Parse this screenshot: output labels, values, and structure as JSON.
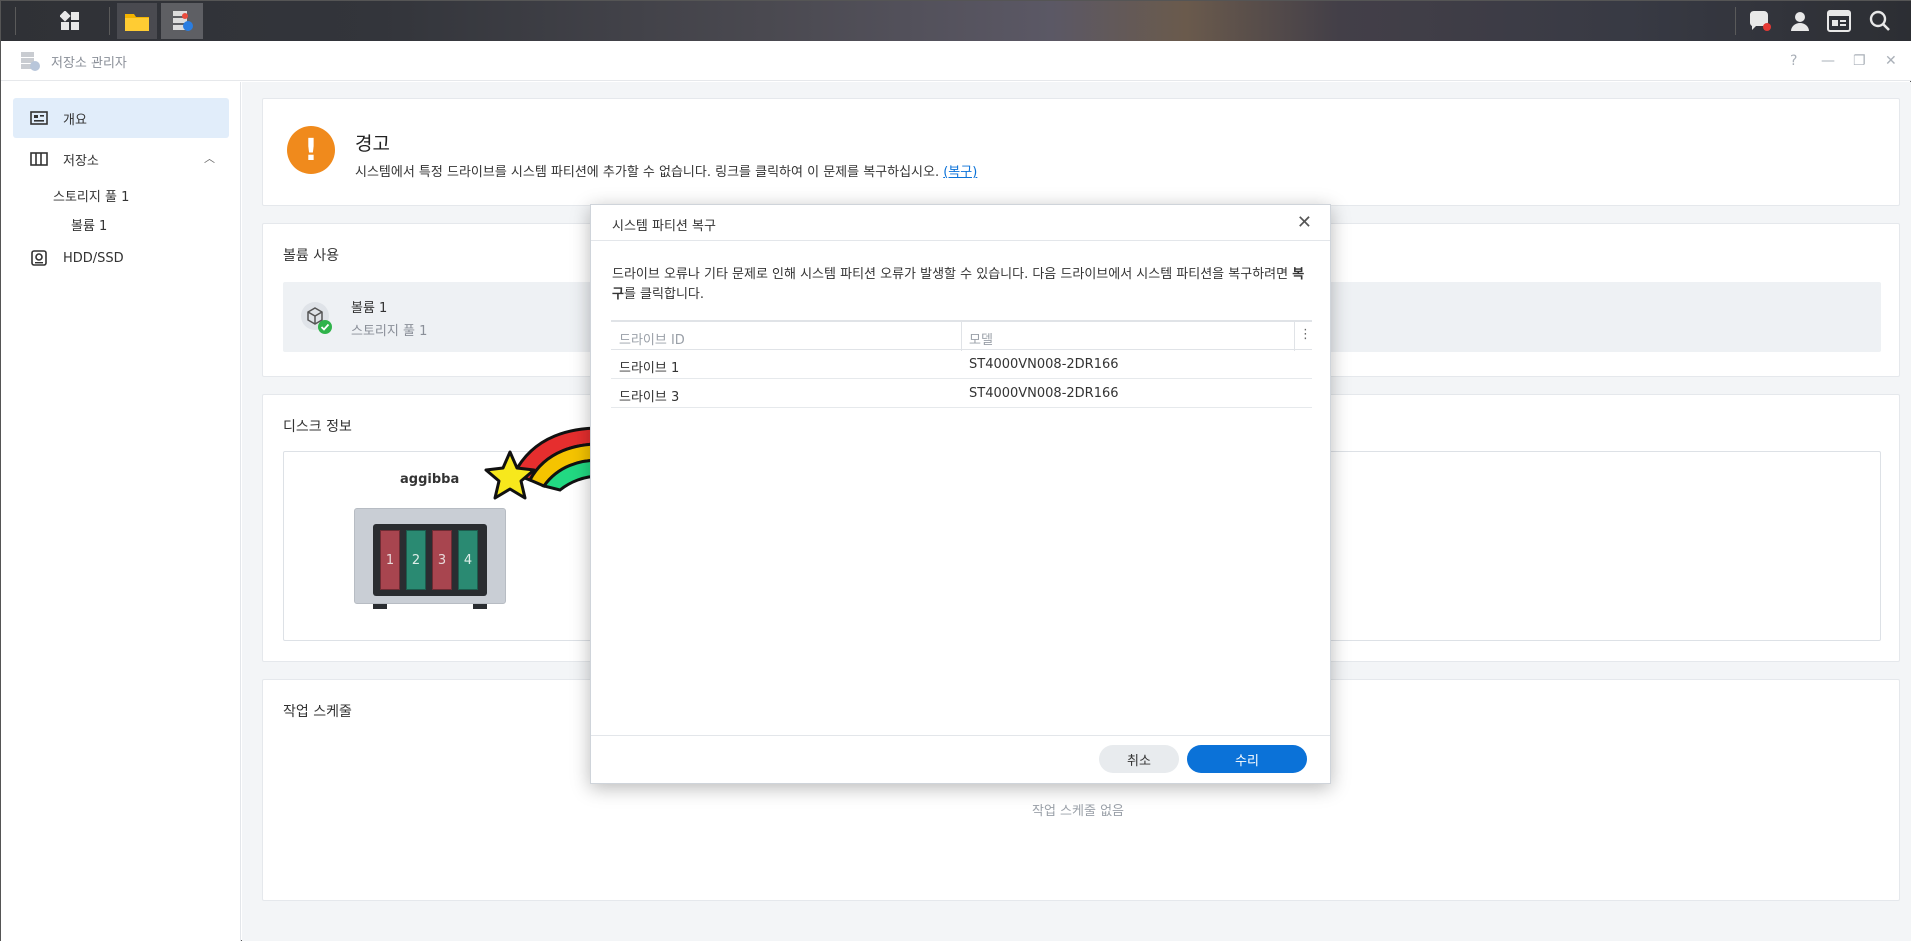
{
  "window": {
    "title": "저장소 관리자"
  },
  "sidebar": {
    "items": [
      {
        "label": "개요"
      },
      {
        "label": "저장소"
      },
      {
        "label": "스토리지 풀 1"
      },
      {
        "label": "볼륨 1"
      },
      {
        "label": "HDD/SSD"
      }
    ]
  },
  "warning": {
    "title": "경고",
    "message": "시스템에서 특정 드라이브를 시스템 파티션에 추가할 수 없습니다. 링크를 클릭하여 이 문제를 복구하십시오.",
    "link": "(복구)"
  },
  "volume_usage": {
    "title": "볼륨 사용",
    "volume_name": "볼륨 1",
    "pool_name": "스토리지 풀 1"
  },
  "disk_info": {
    "title": "디스크 정보",
    "device_name": "aggibba",
    "slots": [
      "1",
      "2",
      "3",
      "4"
    ]
  },
  "schedule": {
    "title": "작업 스케줄",
    "empty": "작업 스케줄 없음"
  },
  "dialog": {
    "title": "시스템 파티션 복구",
    "desc_part1": "드라이브 오류나 기타 문제로 인해 시스템 파티션 오류가 발생할 수 있습니다. 다음 드라이브에서 시스템 파티션을 복구하려면 ",
    "desc_bold": "복구",
    "desc_part2": "를 클릭합니다.",
    "columns": {
      "drive": "드라이브 ID",
      "model": "모델"
    },
    "rows": [
      {
        "drive": "드라이브 1",
        "model": "ST4000VN008-2DR166"
      },
      {
        "drive": "드라이브 3",
        "model": "ST4000VN008-2DR166"
      }
    ],
    "cancel": "취소",
    "ok": "수리"
  },
  "colors": {
    "accent": "#0b72d8",
    "warning": "#f08a1c",
    "slot_red": "#a8454f",
    "slot_green": "#2a8a72"
  }
}
